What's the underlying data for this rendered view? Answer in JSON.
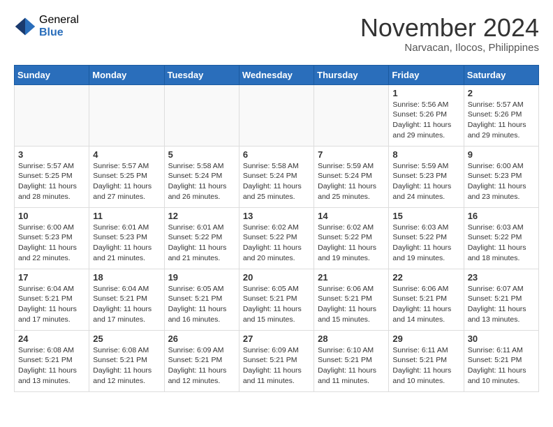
{
  "header": {
    "logo_general": "General",
    "logo_blue": "Blue",
    "month_title": "November 2024",
    "location": "Narvacan, Ilocos, Philippines"
  },
  "weekdays": [
    "Sunday",
    "Monday",
    "Tuesday",
    "Wednesday",
    "Thursday",
    "Friday",
    "Saturday"
  ],
  "weeks": [
    [
      {
        "day": "",
        "info": ""
      },
      {
        "day": "",
        "info": ""
      },
      {
        "day": "",
        "info": ""
      },
      {
        "day": "",
        "info": ""
      },
      {
        "day": "",
        "info": ""
      },
      {
        "day": "1",
        "info": "Sunrise: 5:56 AM\nSunset: 5:26 PM\nDaylight: 11 hours and 29 minutes."
      },
      {
        "day": "2",
        "info": "Sunrise: 5:57 AM\nSunset: 5:26 PM\nDaylight: 11 hours and 29 minutes."
      }
    ],
    [
      {
        "day": "3",
        "info": "Sunrise: 5:57 AM\nSunset: 5:25 PM\nDaylight: 11 hours and 28 minutes."
      },
      {
        "day": "4",
        "info": "Sunrise: 5:57 AM\nSunset: 5:25 PM\nDaylight: 11 hours and 27 minutes."
      },
      {
        "day": "5",
        "info": "Sunrise: 5:58 AM\nSunset: 5:24 PM\nDaylight: 11 hours and 26 minutes."
      },
      {
        "day": "6",
        "info": "Sunrise: 5:58 AM\nSunset: 5:24 PM\nDaylight: 11 hours and 25 minutes."
      },
      {
        "day": "7",
        "info": "Sunrise: 5:59 AM\nSunset: 5:24 PM\nDaylight: 11 hours and 25 minutes."
      },
      {
        "day": "8",
        "info": "Sunrise: 5:59 AM\nSunset: 5:23 PM\nDaylight: 11 hours and 24 minutes."
      },
      {
        "day": "9",
        "info": "Sunrise: 6:00 AM\nSunset: 5:23 PM\nDaylight: 11 hours and 23 minutes."
      }
    ],
    [
      {
        "day": "10",
        "info": "Sunrise: 6:00 AM\nSunset: 5:23 PM\nDaylight: 11 hours and 22 minutes."
      },
      {
        "day": "11",
        "info": "Sunrise: 6:01 AM\nSunset: 5:23 PM\nDaylight: 11 hours and 21 minutes."
      },
      {
        "day": "12",
        "info": "Sunrise: 6:01 AM\nSunset: 5:22 PM\nDaylight: 11 hours and 21 minutes."
      },
      {
        "day": "13",
        "info": "Sunrise: 6:02 AM\nSunset: 5:22 PM\nDaylight: 11 hours and 20 minutes."
      },
      {
        "day": "14",
        "info": "Sunrise: 6:02 AM\nSunset: 5:22 PM\nDaylight: 11 hours and 19 minutes."
      },
      {
        "day": "15",
        "info": "Sunrise: 6:03 AM\nSunset: 5:22 PM\nDaylight: 11 hours and 19 minutes."
      },
      {
        "day": "16",
        "info": "Sunrise: 6:03 AM\nSunset: 5:22 PM\nDaylight: 11 hours and 18 minutes."
      }
    ],
    [
      {
        "day": "17",
        "info": "Sunrise: 6:04 AM\nSunset: 5:21 PM\nDaylight: 11 hours and 17 minutes."
      },
      {
        "day": "18",
        "info": "Sunrise: 6:04 AM\nSunset: 5:21 PM\nDaylight: 11 hours and 17 minutes."
      },
      {
        "day": "19",
        "info": "Sunrise: 6:05 AM\nSunset: 5:21 PM\nDaylight: 11 hours and 16 minutes."
      },
      {
        "day": "20",
        "info": "Sunrise: 6:05 AM\nSunset: 5:21 PM\nDaylight: 11 hours and 15 minutes."
      },
      {
        "day": "21",
        "info": "Sunrise: 6:06 AM\nSunset: 5:21 PM\nDaylight: 11 hours and 15 minutes."
      },
      {
        "day": "22",
        "info": "Sunrise: 6:06 AM\nSunset: 5:21 PM\nDaylight: 11 hours and 14 minutes."
      },
      {
        "day": "23",
        "info": "Sunrise: 6:07 AM\nSunset: 5:21 PM\nDaylight: 11 hours and 13 minutes."
      }
    ],
    [
      {
        "day": "24",
        "info": "Sunrise: 6:08 AM\nSunset: 5:21 PM\nDaylight: 11 hours and 13 minutes."
      },
      {
        "day": "25",
        "info": "Sunrise: 6:08 AM\nSunset: 5:21 PM\nDaylight: 11 hours and 12 minutes."
      },
      {
        "day": "26",
        "info": "Sunrise: 6:09 AM\nSunset: 5:21 PM\nDaylight: 11 hours and 12 minutes."
      },
      {
        "day": "27",
        "info": "Sunrise: 6:09 AM\nSunset: 5:21 PM\nDaylight: 11 hours and 11 minutes."
      },
      {
        "day": "28",
        "info": "Sunrise: 6:10 AM\nSunset: 5:21 PM\nDaylight: 11 hours and 11 minutes."
      },
      {
        "day": "29",
        "info": "Sunrise: 6:11 AM\nSunset: 5:21 PM\nDaylight: 11 hours and 10 minutes."
      },
      {
        "day": "30",
        "info": "Sunrise: 6:11 AM\nSunset: 5:21 PM\nDaylight: 11 hours and 10 minutes."
      }
    ]
  ]
}
